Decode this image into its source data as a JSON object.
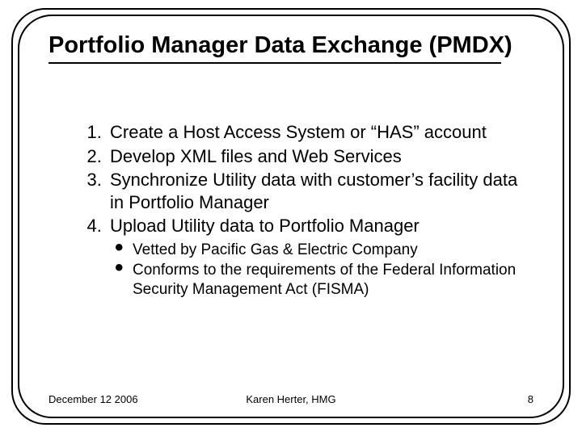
{
  "title": "Portfolio Manager Data Exchange (PMDX)",
  "list": {
    "items": [
      "Create a Host Access System or “HAS” account",
      "Develop XML files and Web Services",
      "Synchronize Utility data with customer’s facility data in Portfolio Manager",
      "Upload Utility data to Portfolio Manager"
    ],
    "sub": [
      "Vetted by Pacific Gas & Electric Company",
      "Conforms to the requirements of the Federal Information Security Management Act (FISMA)"
    ]
  },
  "footer": {
    "date": "December 12 2006",
    "author": "Karen Herter, HMG",
    "page": "8"
  }
}
